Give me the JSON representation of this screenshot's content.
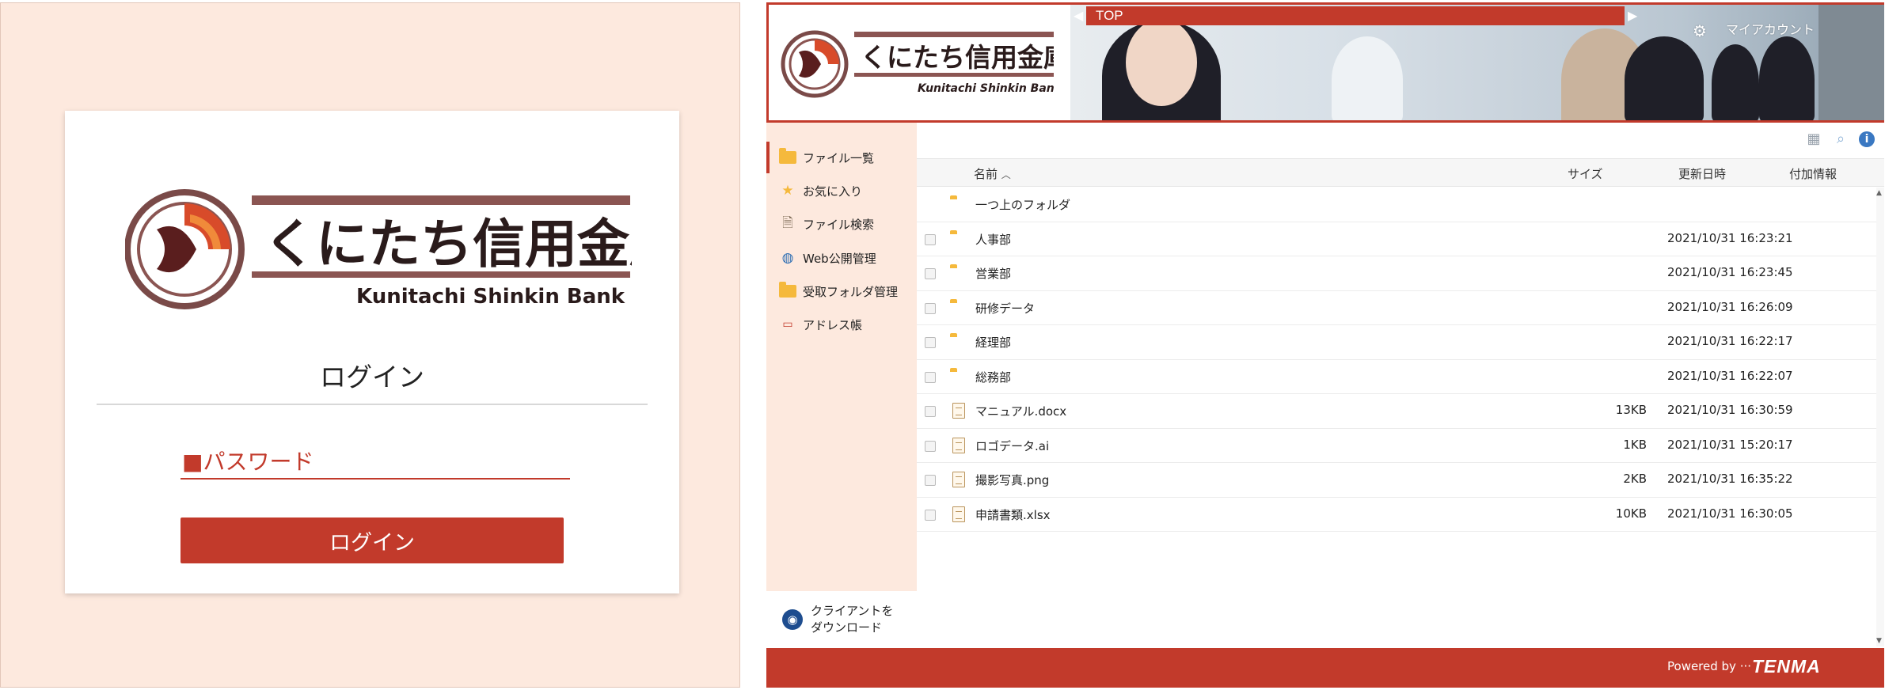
{
  "login": {
    "logo_text_jp": "くにたち信用金庫",
    "logo_text_en": "Kunitachi Shinkin Bank",
    "title": "ログイン",
    "password_placeholder": "■パスワード",
    "button_label": "ログイン"
  },
  "app": {
    "header": {
      "logo_text_jp": "くにたち信用金庫",
      "logo_text_en": "Kunitachi Shinkin Bank",
      "top_label": "TOP",
      "account_label": "マイアカウント"
    },
    "sidebar": {
      "items": [
        {
          "label": "ファイル一覧",
          "icon": "folder-icon"
        },
        {
          "label": "お気に入り",
          "icon": "star-icon"
        },
        {
          "label": "ファイル検索",
          "icon": "file-search-icon"
        },
        {
          "label": "Web公開管理",
          "icon": "globe-icon"
        },
        {
          "label": "受取フォルダ管理",
          "icon": "inbox-folder-icon"
        },
        {
          "label": "アドレス帳",
          "icon": "address-book-icon"
        }
      ],
      "client_download": "クライアントを ダウンロード"
    },
    "columns": {
      "name": "名前",
      "size": "サイズ",
      "updated": "更新日時",
      "info": "付加情報"
    },
    "files": [
      {
        "name": "一つ上のフォルダ",
        "type": "folder",
        "size": "",
        "updated": "",
        "parent": true
      },
      {
        "name": "人事部",
        "type": "folder",
        "size": "",
        "updated": "2021/10/31 16:23:21"
      },
      {
        "name": "営業部",
        "type": "folder",
        "size": "",
        "updated": "2021/10/31 16:23:45"
      },
      {
        "name": "研修データ",
        "type": "folder",
        "size": "",
        "updated": "2021/10/31 16:26:09"
      },
      {
        "name": "経理部",
        "type": "folder",
        "size": "",
        "updated": "2021/10/31 16:22:17"
      },
      {
        "name": "総務部",
        "type": "folder",
        "size": "",
        "updated": "2021/10/31 16:22:07"
      },
      {
        "name": "マニュアル.docx",
        "type": "file",
        "size": "13KB",
        "updated": "2021/10/31 16:30:59"
      },
      {
        "name": "ロゴデータ.ai",
        "type": "file",
        "size": "1KB",
        "updated": "2021/10/31 15:20:17"
      },
      {
        "name": "撮影写真.png",
        "type": "file",
        "size": "2KB",
        "updated": "2021/10/31 16:35:22"
      },
      {
        "name": "申請書類.xlsx",
        "type": "file",
        "size": "10KB",
        "updated": "2021/10/31 16:30:05"
      }
    ],
    "footer": {
      "powered_by": "Powered by ···",
      "brand": "TENMA"
    }
  },
  "colors": {
    "accent": "#c23a2b",
    "login_bg": "#fde9de",
    "folder": "#f5b93c"
  }
}
